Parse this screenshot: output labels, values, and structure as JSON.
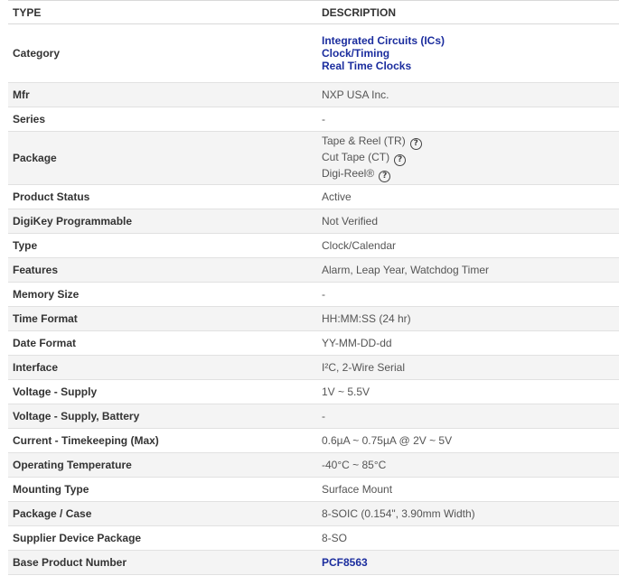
{
  "table": {
    "headers": {
      "type": "TYPE",
      "description": "DESCRIPTION"
    },
    "category": {
      "label": "Category",
      "links": [
        "Integrated Circuits (ICs)",
        "Clock/Timing",
        "Real Time Clocks"
      ]
    },
    "mfr": {
      "label": "Mfr",
      "value": "NXP USA Inc."
    },
    "series": {
      "label": "Series",
      "value": "-"
    },
    "package": {
      "label": "Package",
      "options": [
        "Tape & Reel (TR)",
        "Cut Tape (CT)",
        "Digi-Reel®"
      ],
      "help_icon": "question-circle-icon"
    },
    "product_status": {
      "label": "Product Status",
      "value": "Active"
    },
    "digikey_programmable": {
      "label": "DigiKey Programmable",
      "value": "Not Verified"
    },
    "type": {
      "label": "Type",
      "value": "Clock/Calendar"
    },
    "features": {
      "label": "Features",
      "value": "Alarm, Leap Year, Watchdog Timer"
    },
    "memory_size": {
      "label": "Memory Size",
      "value": "-"
    },
    "time_format": {
      "label": "Time Format",
      "value": "HH:MM:SS (24 hr)"
    },
    "date_format": {
      "label": "Date Format",
      "value": "YY-MM-DD-dd"
    },
    "interface": {
      "label": "Interface",
      "value": "I²C, 2-Wire Serial"
    },
    "voltage_supply": {
      "label": "Voltage - Supply",
      "value": "1V ~ 5.5V"
    },
    "voltage_supply_battery": {
      "label": "Voltage - Supply, Battery",
      "value": "-"
    },
    "current_timekeeping": {
      "label": "Current - Timekeeping (Max)",
      "value": "0.6µA ~ 0.75µA @ 2V ~ 5V"
    },
    "operating_temperature": {
      "label": "Operating Temperature",
      "value": "-40°C ~ 85°C"
    },
    "mounting_type": {
      "label": "Mounting Type",
      "value": "Surface Mount"
    },
    "package_case": {
      "label": "Package / Case",
      "value": "8-SOIC (0.154\", 3.90mm Width)"
    },
    "supplier_device_package": {
      "label": "Supplier Device Package",
      "value": "8-SO"
    },
    "base_product_number": {
      "label": "Base Product Number",
      "value": "PCF8563"
    }
  },
  "colors": {
    "link": "#1b2d9e",
    "row_alt": "#f4f4f4",
    "border": "#e1e1e1",
    "text": "#333333"
  }
}
